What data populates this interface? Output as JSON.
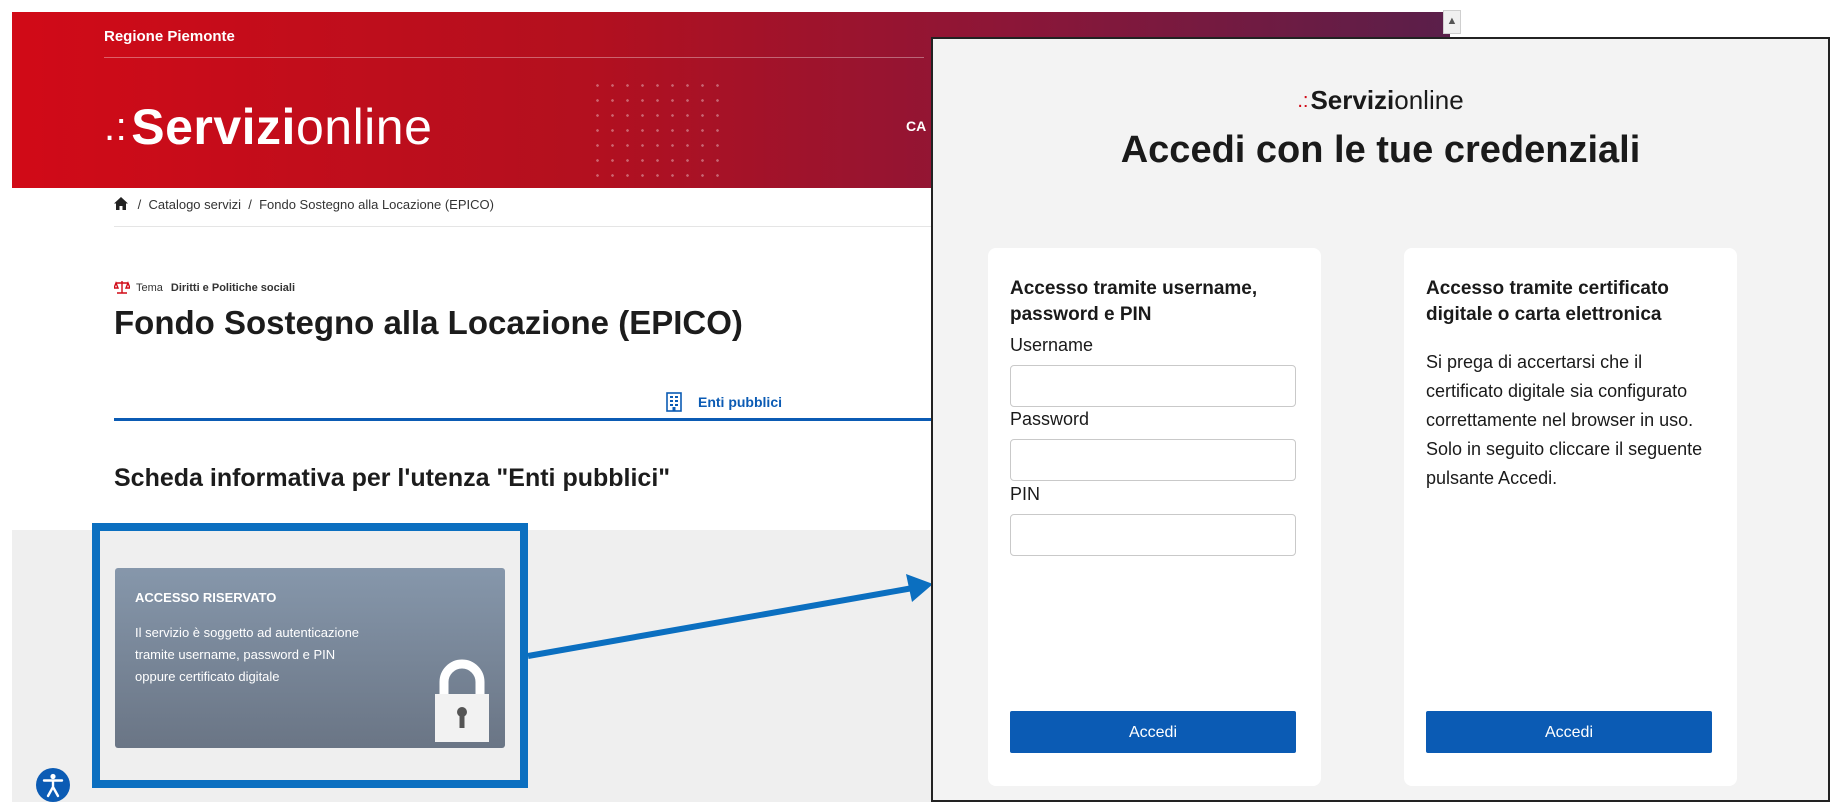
{
  "header": {
    "region": "Regione Piemonte",
    "logo_bold": "Servizi",
    "logo_light": "online",
    "nav_partial": "CA"
  },
  "breadcrumb": {
    "separator": "/",
    "items": [
      "Catalogo servizi",
      "Fondo Sostegno alla Locazione (EPICO)"
    ]
  },
  "topic": {
    "label": "Tema",
    "value": "Diritti e Politiche sociali"
  },
  "page_title": "Fondo Sostegno alla Locazione (EPICO)",
  "tab": {
    "label": "Enti pubblici"
  },
  "section_title": "Scheda informativa per l'utenza \"Enti pubblici\"",
  "access_card": {
    "title": "ACCESSO RISERVATO",
    "lines": [
      "Il servizio è soggetto ad autenticazione",
      "tramite username, password e PIN",
      "oppure certificato digitale"
    ]
  },
  "dialog": {
    "logo_bold": "Servizi",
    "logo_light": "online",
    "title": "Accedi con le tue credenziali",
    "left_panel": {
      "heading_lines": [
        "Accesso tramite username,",
        "password e PIN"
      ],
      "username_label": "Username",
      "username_value": "",
      "password_label": "Password",
      "password_value": "",
      "pin_label": "PIN",
      "pin_value": "",
      "button": "Accedi"
    },
    "right_panel": {
      "heading_lines": [
        "Accesso tramite certificato",
        "digitale o carta elettronica"
      ],
      "text_lines": [
        "Si prega di accertarsi che il",
        "certificato digitale sia configurato",
        "correttamente nel browser in uso.",
        "Solo in seguito cliccare il seguente",
        "pulsante Accedi."
      ],
      "button": "Accedi"
    }
  },
  "colors": {
    "brand_red": "#d10a17",
    "primary_blue": "#0b5bb4",
    "callout_blue": "#0b6fc0",
    "card_grey": "#7b889a"
  },
  "icons": [
    "home-icon",
    "scale-icon",
    "building-icon",
    "lock-icon",
    "accessibility-icon",
    "scroll-up-arrow-icon"
  ]
}
